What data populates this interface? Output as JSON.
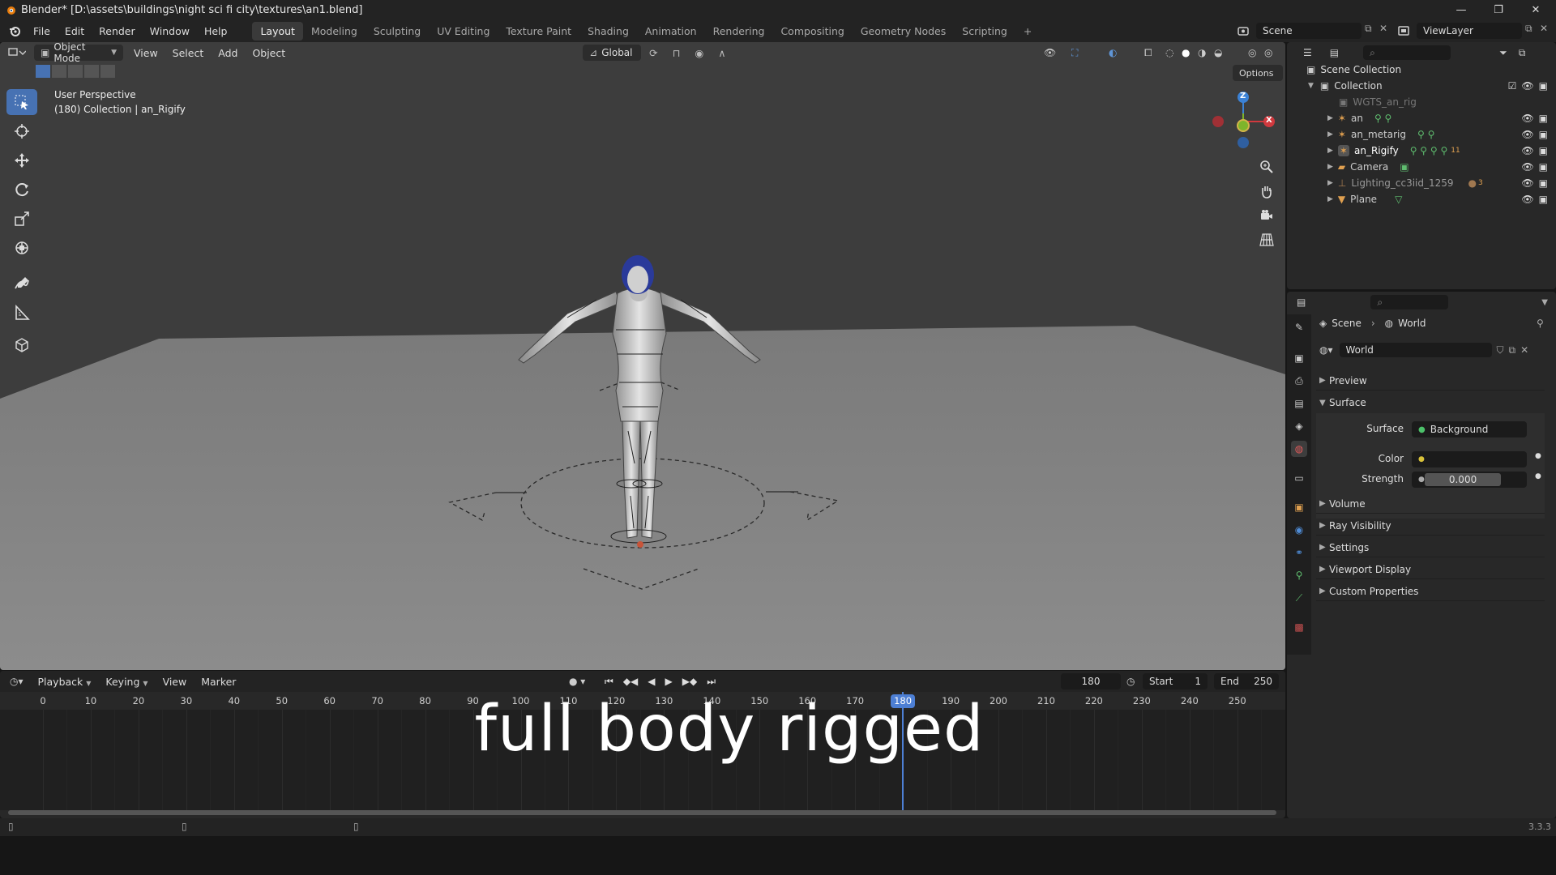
{
  "window": {
    "title": "Blender* [D:\\assets\\buildings\\night sci fi city\\textures\\an1.blend]",
    "controls": [
      "—",
      "❐",
      "✕"
    ]
  },
  "menus": [
    "File",
    "Edit",
    "Render",
    "Window",
    "Help"
  ],
  "workspaces": [
    "Layout",
    "Modeling",
    "Sculpting",
    "UV Editing",
    "Texture Paint",
    "Shading",
    "Animation",
    "Rendering",
    "Compositing",
    "Geometry Nodes",
    "Scripting"
  ],
  "active_workspace": "Layout",
  "add_workspace": "+",
  "scene_field": "Scene",
  "viewlayer_field": "ViewLayer",
  "viewport": {
    "mode": "Object Mode",
    "menus": [
      "View",
      "Select",
      "Add",
      "Object"
    ],
    "transform_orientation": "Global",
    "options": "Options",
    "overlay_title": "User Perspective",
    "overlay_subtitle": "(180) Collection | an_Rigify",
    "gizmo_axes": {
      "z": "Z",
      "x": "X"
    }
  },
  "outliner": {
    "scene_collection": "Scene Collection",
    "collection": "Collection",
    "items": [
      {
        "name": "WGTS_an_rig",
        "dim": true
      },
      {
        "name": "an",
        "dim": false
      },
      {
        "name": "an_metarig",
        "dim": false
      },
      {
        "name": "an_Rigify",
        "dim": false,
        "badge": "11"
      },
      {
        "name": "Camera",
        "dim": false
      },
      {
        "name": "Lighting_cc3iid_1259",
        "dim": false,
        "badge": "3"
      },
      {
        "name": "Plane",
        "dim": false
      }
    ]
  },
  "properties": {
    "breadcrumb": [
      "Scene",
      "World"
    ],
    "world_name": "World",
    "panels_top": [
      "Preview",
      "Surface"
    ],
    "surface_label": "Surface",
    "surface_value": "Background",
    "color_label": "Color",
    "strength_label": "Strength",
    "strength_value": "0.000",
    "panels_bottom": [
      "Volume",
      "Ray Visibility",
      "Settings",
      "Viewport Display",
      "Custom Properties"
    ]
  },
  "timeline": {
    "menus": [
      "Playback",
      "Keying",
      "View",
      "Marker"
    ],
    "current_frame": "180",
    "start_label": "Start",
    "start_value": "1",
    "end_label": "End",
    "end_value": "250",
    "ticks": [
      "0",
      "10",
      "20",
      "30",
      "40",
      "50",
      "60",
      "70",
      "80",
      "90",
      "100",
      "110",
      "120",
      "130",
      "140",
      "150",
      "160",
      "170",
      "180",
      "190",
      "200",
      "210",
      "220",
      "230",
      "240",
      "250"
    ],
    "playhead": 180
  },
  "caption": "full body rigged",
  "version": "3.3.3",
  "colors": {
    "accent": "#4772b3",
    "playhead": "#4d7fd4",
    "axis_x": "#d0393e",
    "axis_y": "#7eb52b",
    "axis_z": "#3b82d6"
  }
}
